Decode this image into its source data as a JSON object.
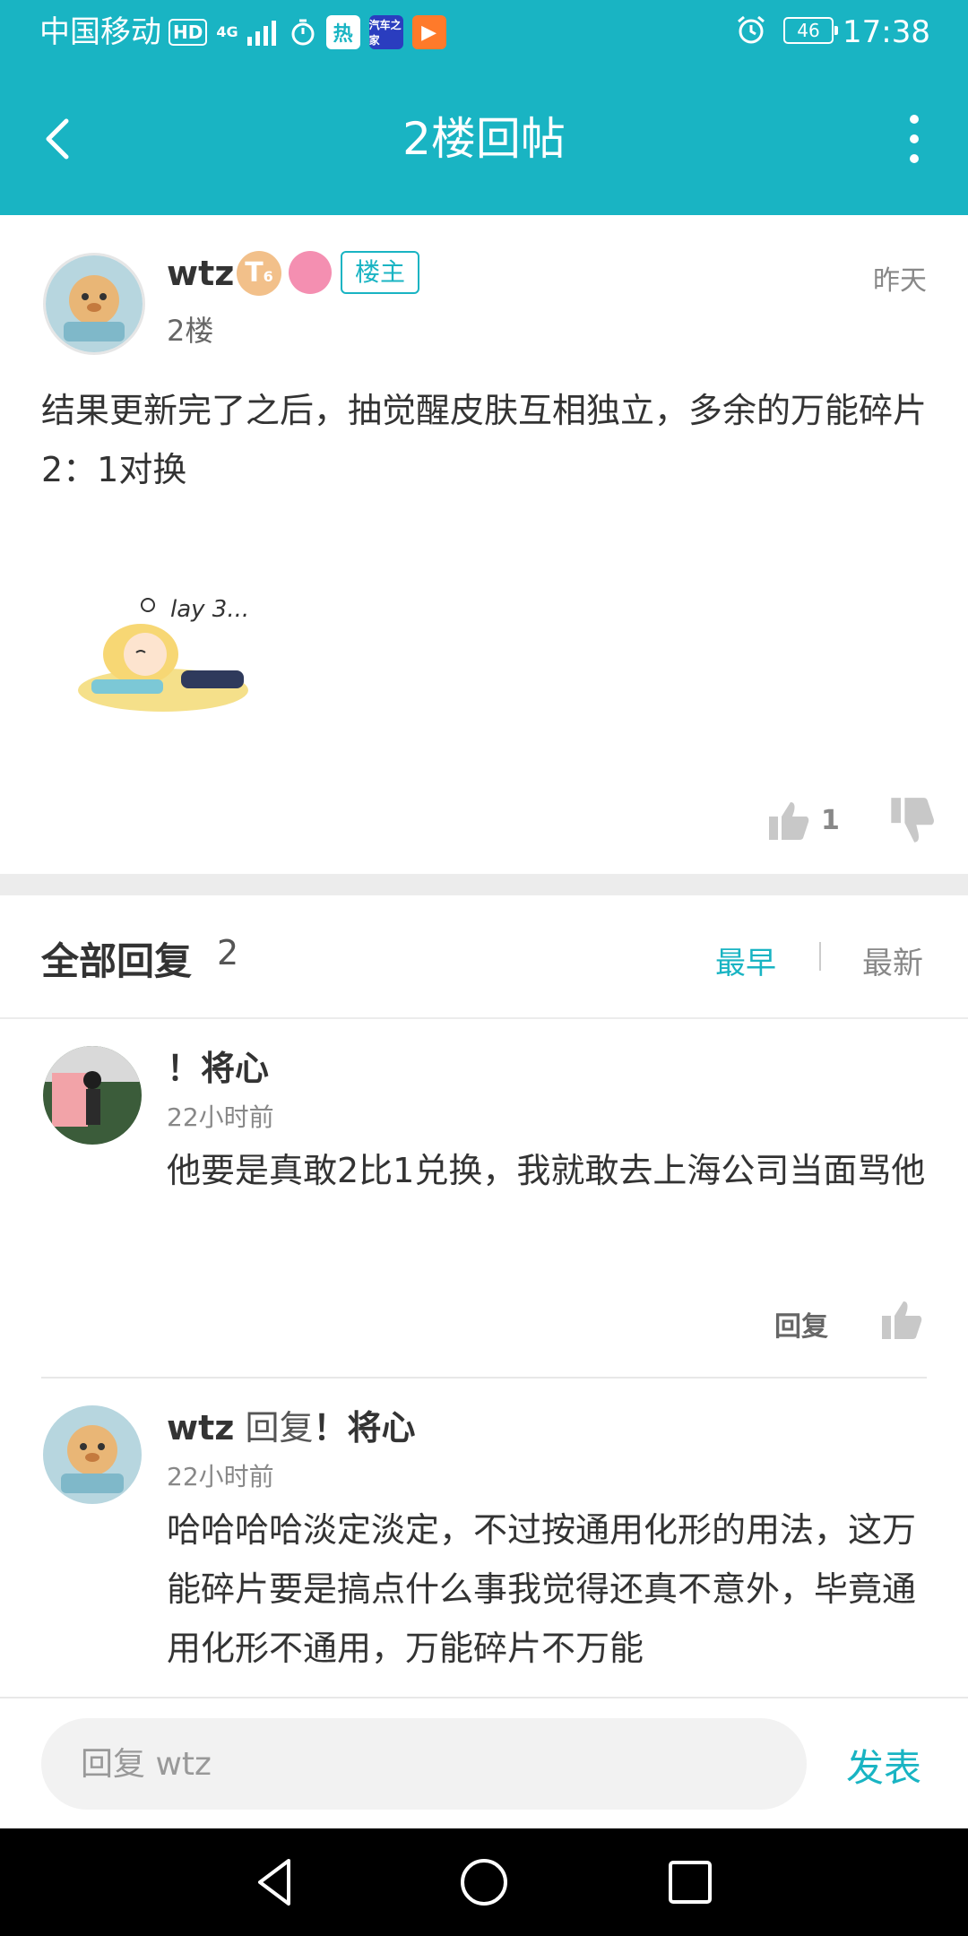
{
  "status_bar": {
    "carrier": "中国移动",
    "hd": "HD",
    "network": "4G",
    "app_hot": "热",
    "app_car": "汽车之家",
    "battery": "46",
    "time": "17:38"
  },
  "header": {
    "title": "2楼回帖"
  },
  "post": {
    "username": "wtz",
    "level_badge": "T",
    "level_sub": "6",
    "owner_tag": "楼主",
    "floor": "2楼",
    "time": "昨天",
    "body": "结果更新完了之后，抽觉醒皮肤互相独立，多余的万能碎片2：1对换",
    "sticker_text": "lay 3...",
    "like_count": "1"
  },
  "replies_header": {
    "title": "全部回复",
    "count": "2",
    "sort_earliest": "最早",
    "sort_latest": "最新"
  },
  "replies": [
    {
      "name": "！将心",
      "time": "22小时前",
      "body": "他要是真敢2比1兑换，我就敢去上海公司当面骂他",
      "reply_label": "回复"
    },
    {
      "name": "wtz",
      "reply_word": "回复",
      "reply_to": "！将心",
      "time": "22小时前",
      "body": "哈哈哈哈淡定淡定，不过按通用化形的用法，这万能碎片要是搞点什么事我觉得还真不意外，毕竟通用化形不通用，万能碎片不万能"
    }
  ],
  "input": {
    "placeholder": "回复 wtz",
    "send_label": "发表"
  },
  "colors": {
    "accent": "#19b4c3"
  }
}
